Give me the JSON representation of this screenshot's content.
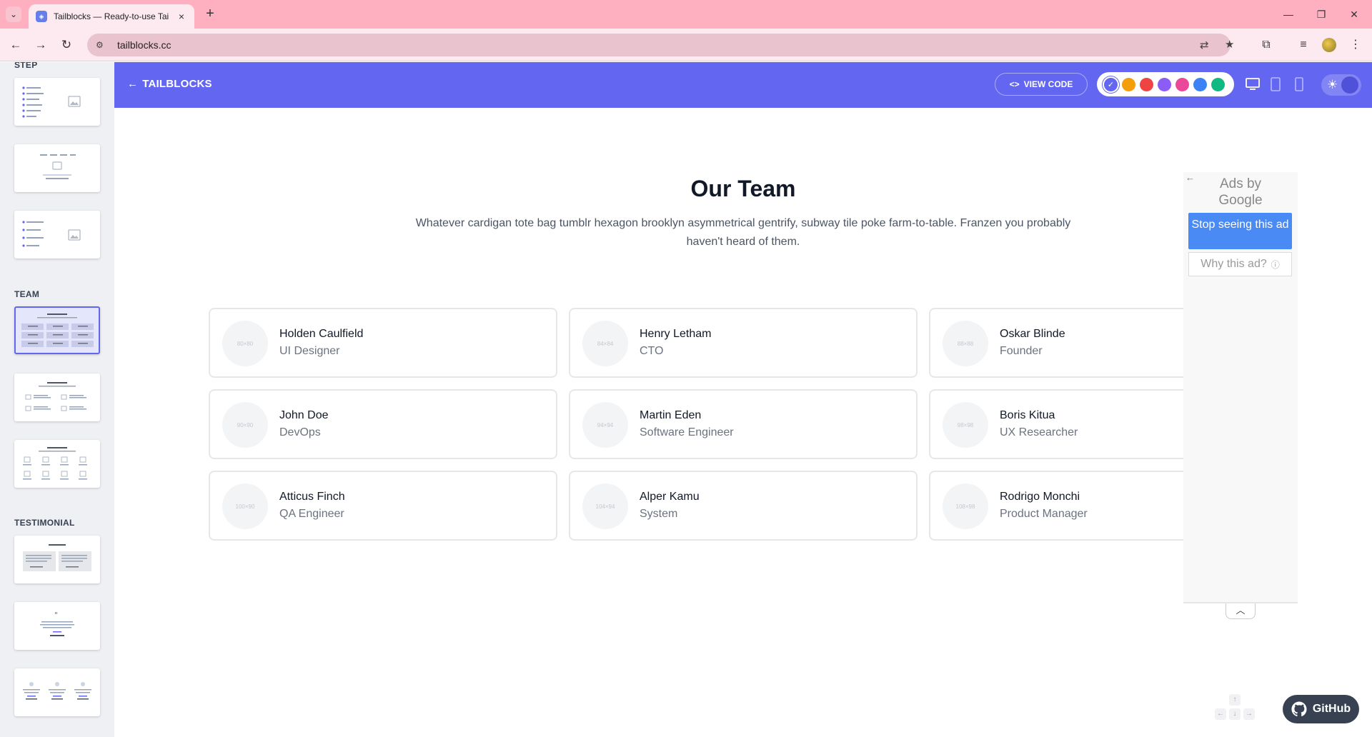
{
  "browser": {
    "tab_title": "Tailblocks — Ready-to-use Tai",
    "url": "tailblocks.cc",
    "new_tab": "+",
    "tab_close": "×"
  },
  "sidebar": {
    "sections": [
      {
        "label": "STEP"
      },
      {
        "label": "TEAM"
      },
      {
        "label": "TESTIMONIAL"
      }
    ]
  },
  "appbar": {
    "back_label": "TAILBLOCKS",
    "view_code_label": "VIEW CODE",
    "swatch_colors": [
      "#6366f1",
      "#f59e0b",
      "#ef4444",
      "#8b5cf6",
      "#ec4899",
      "#3b82f6",
      "#10b981"
    ],
    "selected_swatch": 0,
    "dark_mode": false
  },
  "content": {
    "title": "Our Team",
    "description": "Whatever cardigan tote bag tumblr hexagon brooklyn asymmetrical gentrify, subway tile poke farm-to-table. Franzen you probably haven't heard of them.",
    "members": [
      {
        "name": "Holden Caulfield",
        "role": "UI Designer",
        "avatar": "80×80"
      },
      {
        "name": "Henry Letham",
        "role": "CTO",
        "avatar": "84×84"
      },
      {
        "name": "Oskar Blinde",
        "role": "Founder",
        "avatar": "88×88"
      },
      {
        "name": "John Doe",
        "role": "DevOps",
        "avatar": "90×90"
      },
      {
        "name": "Martin Eden",
        "role": "Software Engineer",
        "avatar": "94×94"
      },
      {
        "name": "Boris Kitua",
        "role": "UX Researcher",
        "avatar": "98×98"
      },
      {
        "name": "Atticus Finch",
        "role": "QA Engineer",
        "avatar": "100×90"
      },
      {
        "name": "Alper Kamu",
        "role": "System",
        "avatar": "104×94"
      },
      {
        "name": "Rodrigo Monchi",
        "role": "Product Manager",
        "avatar": "108×98"
      }
    ]
  },
  "ad": {
    "ads_by_line1": "Ads by",
    "ads_by_line2": "Google",
    "stop_label": "Stop seeing this ad",
    "why_label": "Why this ad?"
  },
  "github": {
    "label": "GitHub"
  }
}
